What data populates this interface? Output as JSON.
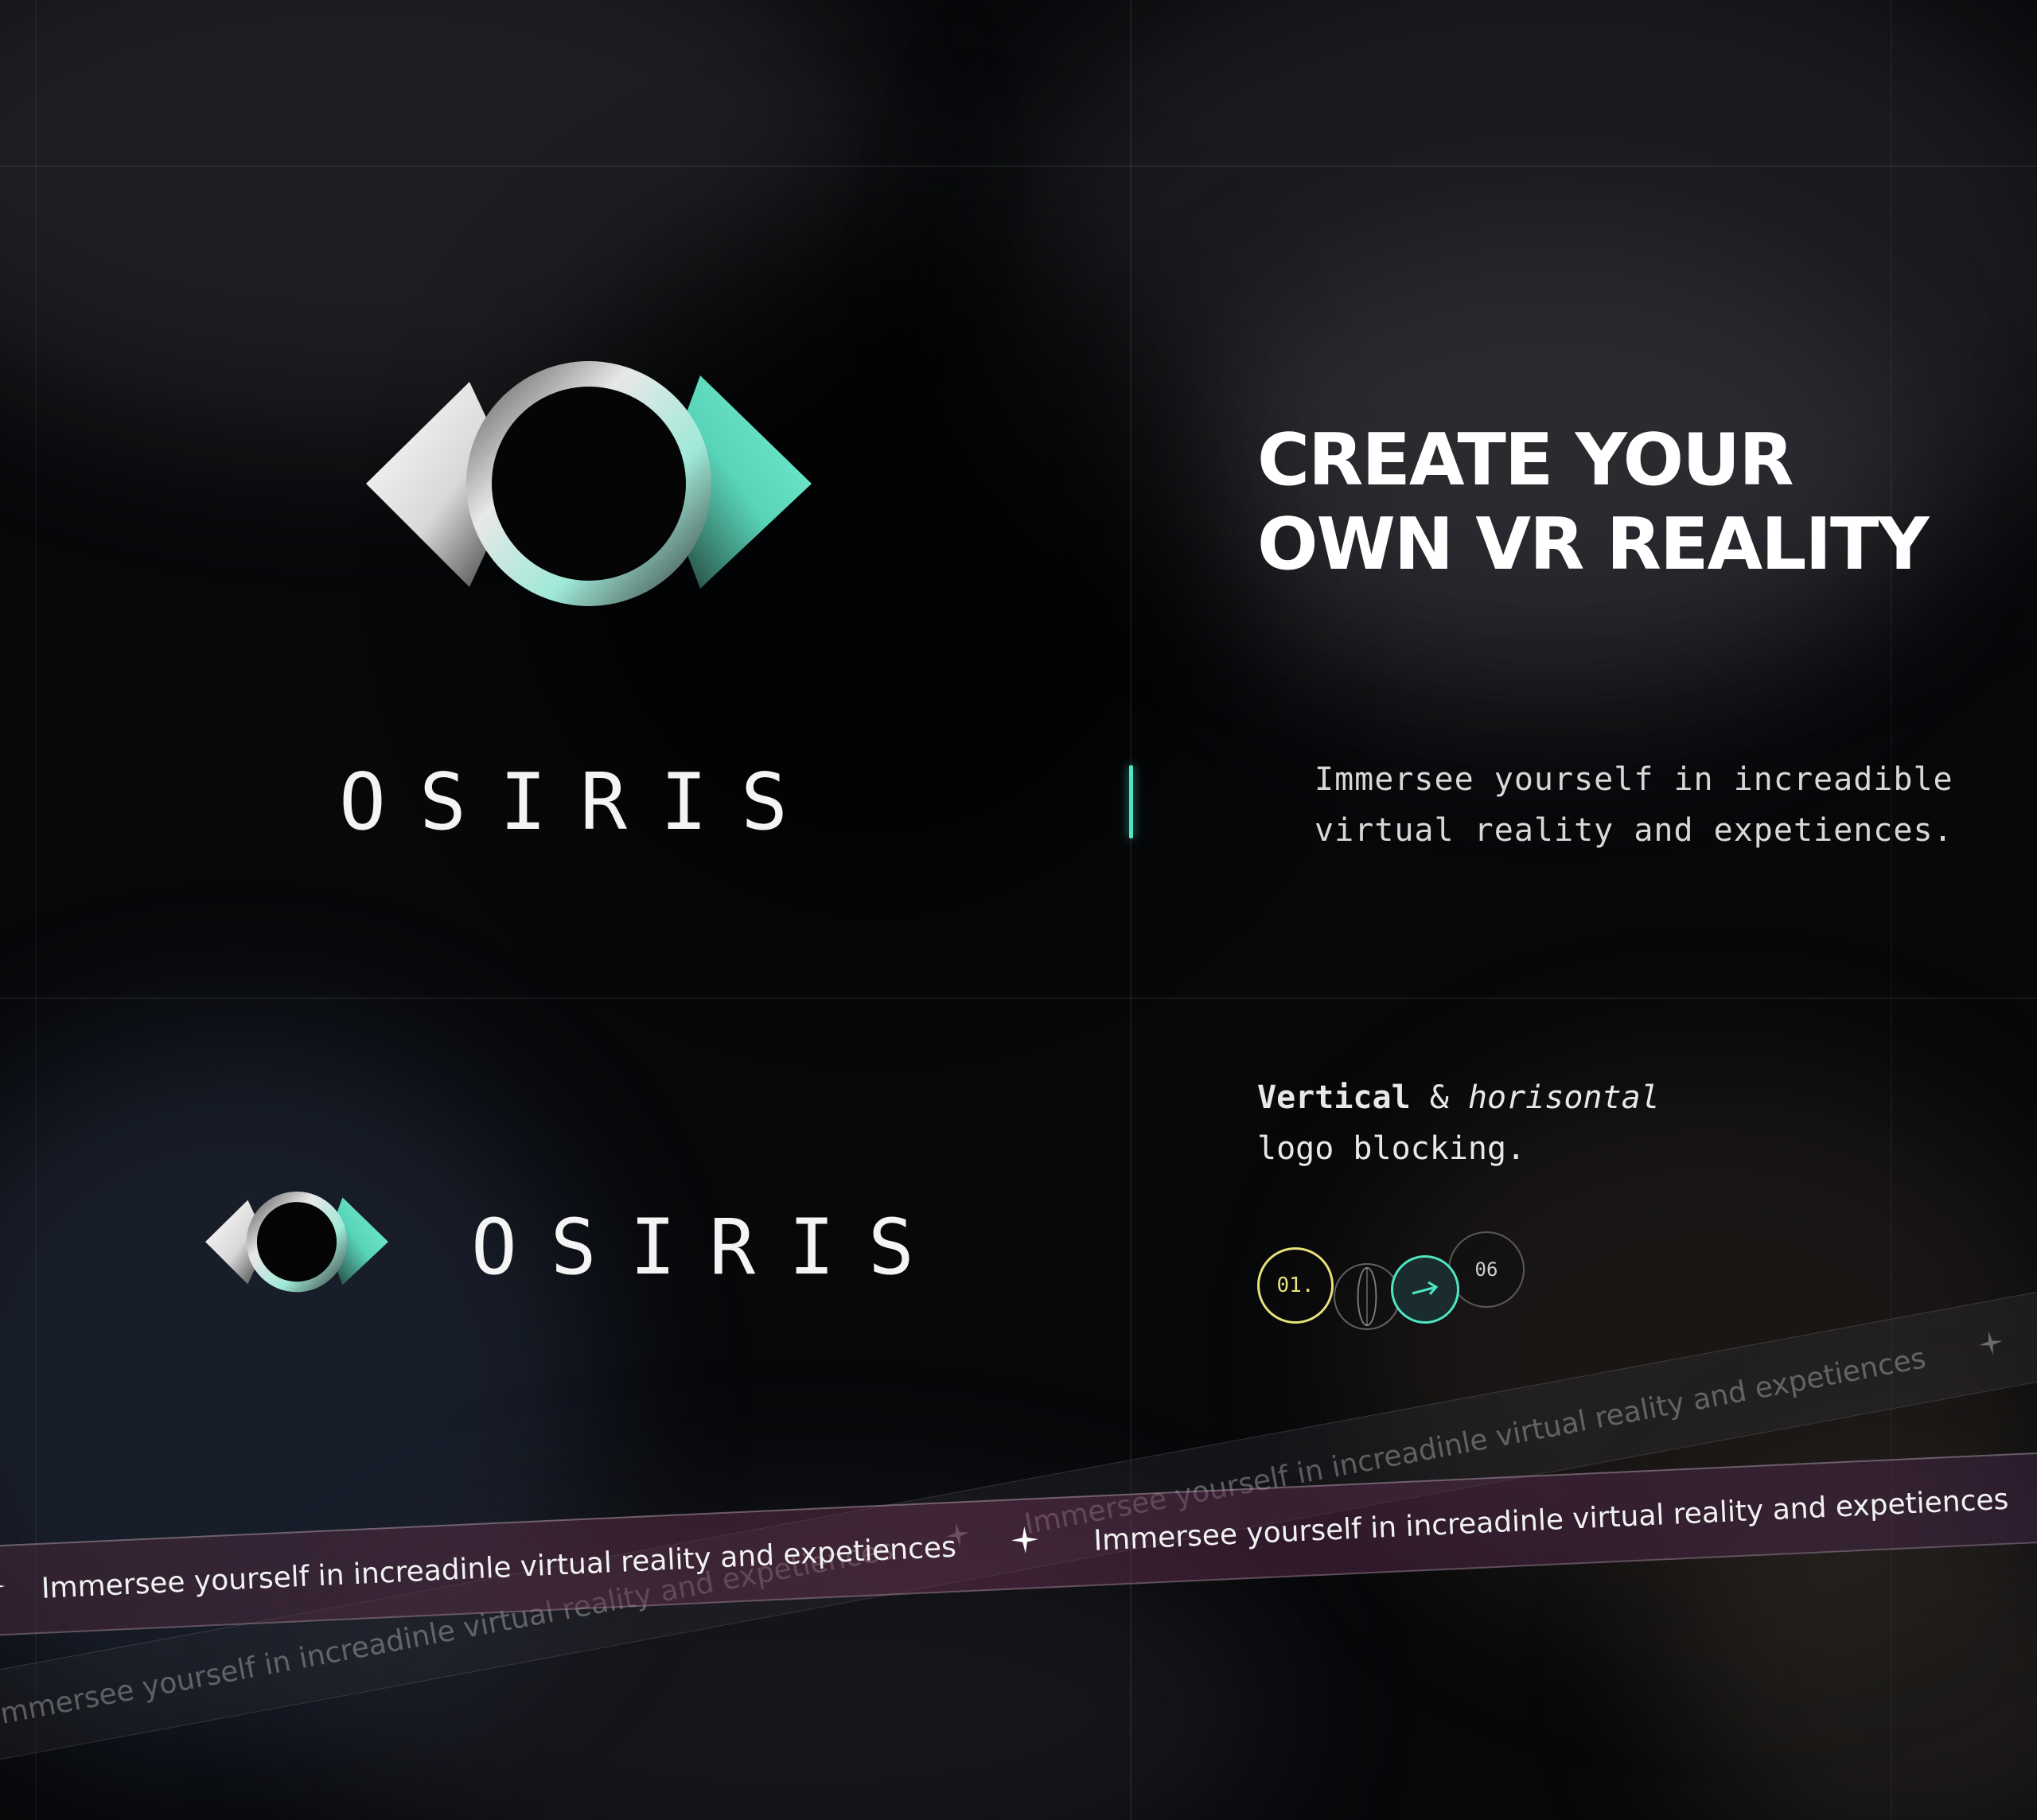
{
  "brand": {
    "wordmark": "OSIRIS",
    "colors": {
      "accent_teal": "#4ee6c4",
      "accent_yellow": "#e9e27a",
      "background": "#07080a",
      "text": "#ffffff"
    }
  },
  "hero": {
    "headline_line1": "CREATE YOUR",
    "headline_line2": "OWN VR REALITY",
    "sub_line1": "Immersee yourself in increadible",
    "sub_line2": "virtual reality and expetiences."
  },
  "logo_section": {
    "bold_word": "Vertical",
    "connector": "&",
    "italic_word": "horisontal",
    "line2": "logo blocking."
  },
  "controls": {
    "index_label": "01.",
    "arrow_icon": "arrow-right-icon",
    "count_label": "06"
  },
  "ribbon": {
    "text": "Immersee yourself in increadinle virtual reality and expetiences",
    "separator_icon": "sparkle-star-icon"
  }
}
